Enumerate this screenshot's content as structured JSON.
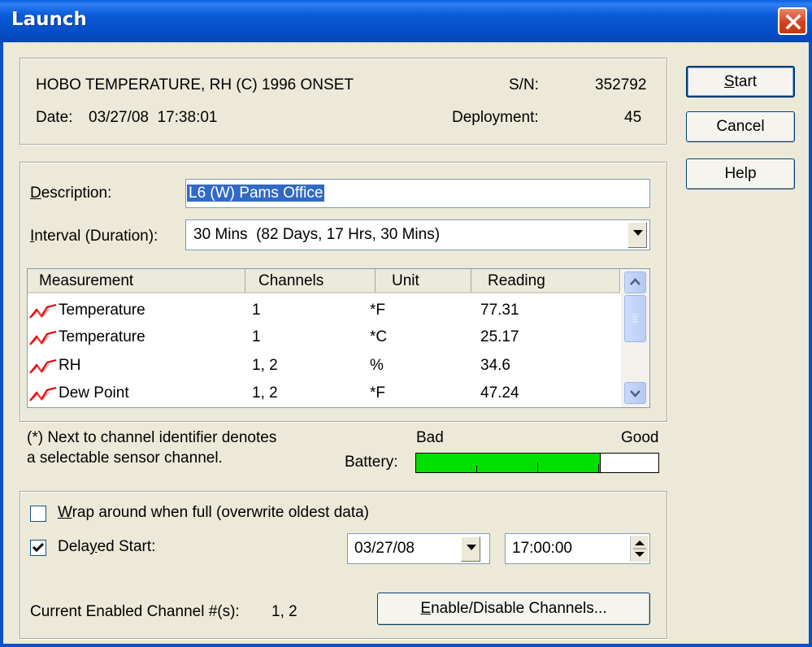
{
  "window": {
    "title": "Launch"
  },
  "device": {
    "name": "HOBO TEMPERATURE, RH (C) 1996 ONSET",
    "date_label": "Date:",
    "date_value": "03/27/08  17:38:01",
    "sn_label": "S/N:",
    "sn_value": "352792",
    "deployment_label": "Deployment:",
    "deployment_value": "45"
  },
  "buttons": {
    "start": {
      "key": "S",
      "rest": "tart"
    },
    "cancel": "Cancel",
    "help": "Help",
    "enable": {
      "key": "E",
      "rest": "nable/Disable Channels..."
    }
  },
  "form": {
    "description_label": {
      "key": "D",
      "rest": "escription:"
    },
    "description_value": "L6 (W) Pams Office",
    "interval_label": {
      "key": "I",
      "rest": "nterval (Duration):"
    },
    "interval_value": "30 Mins  (82 Days, 17 Hrs, 30 Mins)"
  },
  "table": {
    "columns": [
      "Measurement",
      "Channels",
      "Unit",
      "Reading"
    ],
    "rows": [
      {
        "measurement": "Temperature",
        "channels": "1",
        "unit": "*F",
        "reading": "77.31"
      },
      {
        "measurement": "Temperature",
        "channels": "1",
        "unit": "*C",
        "reading": "25.17"
      },
      {
        "measurement": "RH",
        "channels": "1, 2",
        "unit": "%",
        "reading": "34.6"
      },
      {
        "measurement": "Dew Point",
        "channels": "1, 2",
        "unit": "*F",
        "reading": "47.24"
      }
    ],
    "row_icon": "line-graph-icon"
  },
  "note": {
    "line1": "(*) Next to channel identifier denotes",
    "line2": "a selectable sensor channel."
  },
  "battery": {
    "label": "Battery:",
    "bad": "Bad",
    "good": "Good",
    "level": 0.76,
    "color": "#00e000"
  },
  "options": {
    "wrap_label": {
      "key": "W",
      "rest": "rap around when full (overwrite oldest data)"
    },
    "wrap_checked": false,
    "delayed_label": {
      "pre": "Dela",
      "key": "y",
      "rest": "ed Start:"
    },
    "delayed_checked": true,
    "date": "03/27/08",
    "time": "17:00:00"
  },
  "enabled_channels": {
    "label": "Current Enabled Channel #(s):",
    "value": "1, 2"
  }
}
